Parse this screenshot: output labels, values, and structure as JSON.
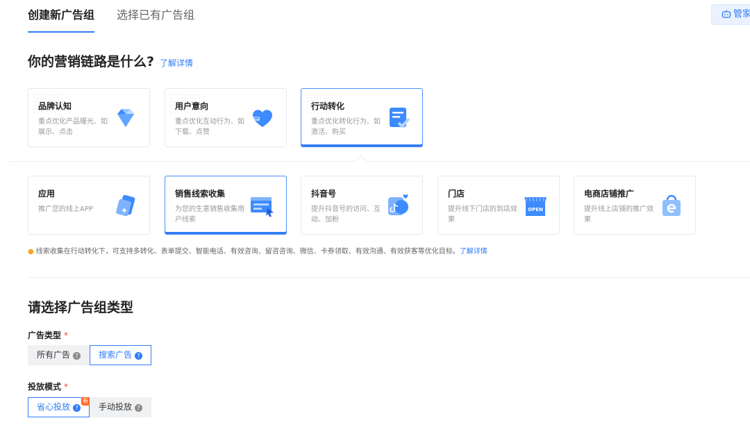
{
  "tabs": [
    {
      "label": "创建新广告组",
      "active": true
    },
    {
      "label": "选择已有广告组",
      "active": false
    }
  ],
  "helper_button": {
    "label": "管家",
    "icon": "robot-icon"
  },
  "marketing": {
    "title": "你的营销链路是什么?",
    "link": "了解详情",
    "goals": [
      {
        "title": "品牌认知",
        "desc": "重点优化产品曝光、如展示、点击",
        "icon": "diamond-icon",
        "selected": false
      },
      {
        "title": "用户意向",
        "desc": "重点优化互动行为、如下载、点赞",
        "icon": "heart-icon",
        "selected": false
      },
      {
        "title": "行动转化",
        "desc": "重点优化转化行为、如激活、购买",
        "icon": "document-check-icon",
        "selected": true
      }
    ],
    "targets": [
      {
        "title": "应用",
        "desc": "推广您的线上APP",
        "icon": "app-card-icon",
        "selected": false
      },
      {
        "title": "销售线索收集",
        "desc": "为您的生意销售收集用户线索",
        "icon": "form-cursor-icon",
        "selected": true
      },
      {
        "title": "抖音号",
        "desc": "提升抖音号的访问、互动、加粉",
        "icon": "douyin-icon",
        "selected": false
      },
      {
        "title": "门店",
        "desc": "提升线下门店的到店效果",
        "icon": "open-shop-icon",
        "selected": false
      },
      {
        "title": "电商店铺推广",
        "desc": "提升线上店铺的推广效果",
        "icon": "ecommerce-bag-icon",
        "selected": false
      }
    ],
    "tip": {
      "text": "线索收集在行动转化下，可支持多转化、表单提交、智能电话、有效咨询、留咨咨询、微信、卡券领取、有效沟通、有效获客等优化目标。",
      "link": "了解详情"
    }
  },
  "group_type": {
    "title": "请选择广告组类型",
    "ad_type": {
      "label": "广告类型",
      "required": "*",
      "options": [
        {
          "label": "所有广告",
          "selected": false
        },
        {
          "label": "搜索广告",
          "selected": true
        }
      ]
    },
    "mode": {
      "label": "投放模式",
      "required": "*",
      "options": [
        {
          "label": "省心投放",
          "selected": true,
          "badge": "新"
        },
        {
          "label": "手动投放",
          "selected": false
        }
      ]
    }
  },
  "colors": {
    "accent": "#2f7cf6",
    "required": "#f04134",
    "badge": "#ff6a2b"
  }
}
